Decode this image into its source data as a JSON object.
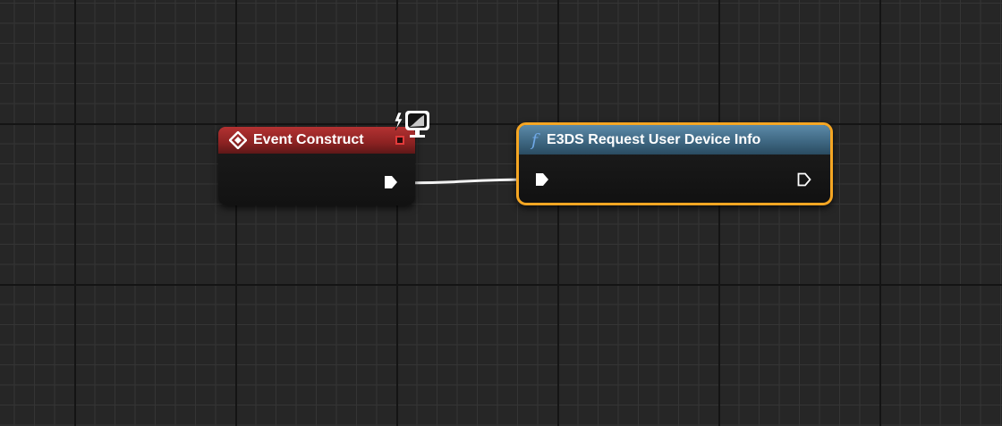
{
  "graph": {
    "background_color": "#262626",
    "grid_minor_color": "#353535",
    "grid_major_color": "#141414"
  },
  "nodes": {
    "event_construct": {
      "title": "Event Construct",
      "header_color": "#a52a2a",
      "icon": "event-diamond-icon",
      "delegate_pin_color": "#e23a3a",
      "exec_output": "connected"
    },
    "e3ds_request": {
      "title": "E3DS Request User Device Info",
      "header_color": "#4a7594",
      "icon": "function-icon",
      "icon_glyph": "f",
      "selected": true,
      "selection_color": "#f5a623",
      "exec_input": "connected",
      "exec_output": "unconnected"
    }
  },
  "wires": [
    {
      "from": "event_construct.exec_out",
      "to": "e3ds_request.exec_in",
      "type": "exec",
      "color": "#ffffff"
    }
  ],
  "icons": {
    "client_badge": "client-widget-icon"
  }
}
